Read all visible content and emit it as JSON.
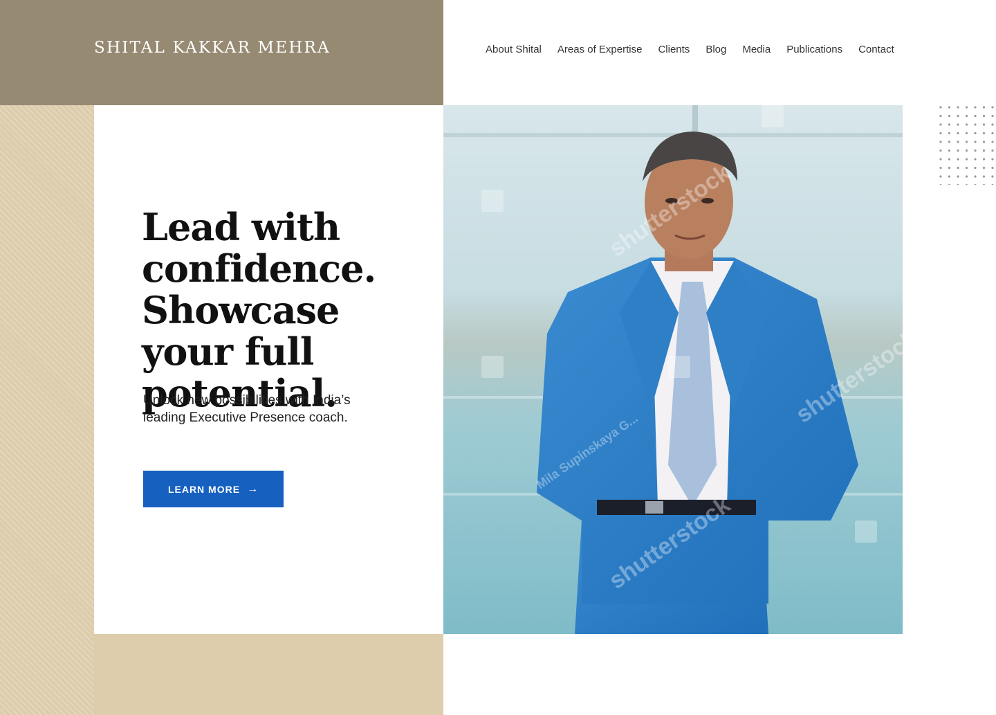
{
  "brand": {
    "name": "SHITAL KAKKAR MEHRA"
  },
  "nav": {
    "items": [
      "About Shital",
      "Areas of Expertise",
      "Clients",
      "Blog",
      "Media",
      "Publications",
      "Contact"
    ]
  },
  "hero": {
    "headline": "Lead with confidence. Showcase your full potential.",
    "subtext": "Unlock new possibilities with India’s leading Executive Presence coach.",
    "cta_label": "LEARN MORE",
    "cta_icon": "arrow-right-icon"
  },
  "photo": {
    "watermark": "shutterstock",
    "credit": "Mila Supinskaya G..."
  },
  "colors": {
    "brand_band": "#968a73",
    "beige": "#ddcdac",
    "cta": "#1661c0",
    "text": "#111111"
  }
}
